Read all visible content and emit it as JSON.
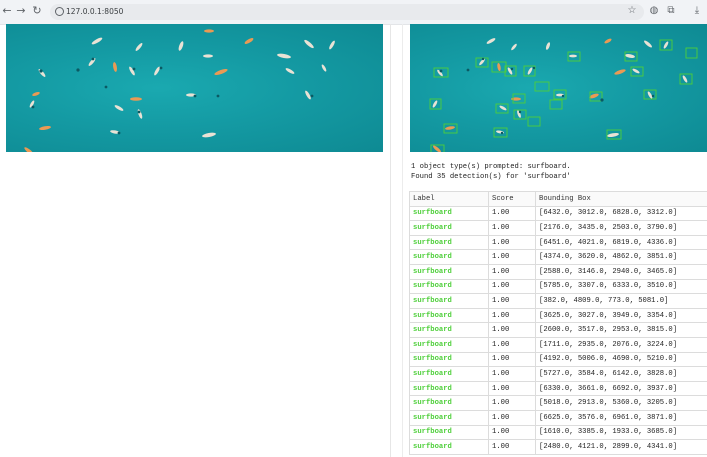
{
  "browser": {
    "url": "127.0.0.1:8050",
    "icons": [
      "back-icon",
      "forward-icon",
      "reload-icon",
      "info-icon",
      "star-icon",
      "extension-icon",
      "puzzle-icon",
      "download-icon"
    ]
  },
  "results": {
    "summary_line1": "1 object type(s) prompted: surfboard.",
    "summary_line2": "Found 35 detection(s) for 'surfboard'",
    "label_color": "#4ecf3a",
    "columns": [
      "Label",
      "Score",
      "Bounding Box"
    ],
    "rows": [
      {
        "label": "surfboard",
        "score": "1.00",
        "bbox": "[6432.0, 3012.0, 6828.0, 3312.0]"
      },
      {
        "label": "surfboard",
        "score": "1.00",
        "bbox": "[2176.0, 3435.0, 2503.0, 3790.0]"
      },
      {
        "label": "surfboard",
        "score": "1.00",
        "bbox": "[6451.0, 4021.0, 6819.0, 4336.0]"
      },
      {
        "label": "surfboard",
        "score": "1.00",
        "bbox": "[4374.0, 3620.0, 4862.0, 3851.0]"
      },
      {
        "label": "surfboard",
        "score": "1.00",
        "bbox": "[2588.0, 3146.0, 2940.0, 3465.0]"
      },
      {
        "label": "surfboard",
        "score": "1.00",
        "bbox": "[5785.0, 3307.0, 6333.0, 3510.0]"
      },
      {
        "label": "surfboard",
        "score": "1.00",
        "bbox": "[382.0, 4809.0, 773.0, 5081.0]"
      },
      {
        "label": "surfboard",
        "score": "1.00",
        "bbox": "[3625.0, 3027.0, 3949.0, 3354.0]"
      },
      {
        "label": "surfboard",
        "score": "1.00",
        "bbox": "[2600.0, 3517.0, 2953.0, 3815.0]"
      },
      {
        "label": "surfboard",
        "score": "1.00",
        "bbox": "[1711.0, 2935.0, 2076.0, 3224.0]"
      },
      {
        "label": "surfboard",
        "score": "1.00",
        "bbox": "[4192.0, 5006.0, 4690.0, 5210.0]"
      },
      {
        "label": "surfboard",
        "score": "1.00",
        "bbox": "[5727.0, 3584.0, 6142.0, 3828.0]"
      },
      {
        "label": "surfboard",
        "score": "1.00",
        "bbox": "[6330.0, 3661.0, 6692.0, 3937.0]"
      },
      {
        "label": "surfboard",
        "score": "1.00",
        "bbox": "[5018.0, 2913.0, 5360.0, 3205.0]"
      },
      {
        "label": "surfboard",
        "score": "1.00",
        "bbox": "[6625.0, 3576.0, 6961.0, 3871.0]"
      },
      {
        "label": "surfboard",
        "score": "1.00",
        "bbox": "[1610.0, 3385.0, 1933.0, 3685.0]"
      },
      {
        "label": "surfboard",
        "score": "1.00",
        "bbox": "[2480.0, 4121.0, 2899.0, 4341.0]"
      }
    ]
  }
}
